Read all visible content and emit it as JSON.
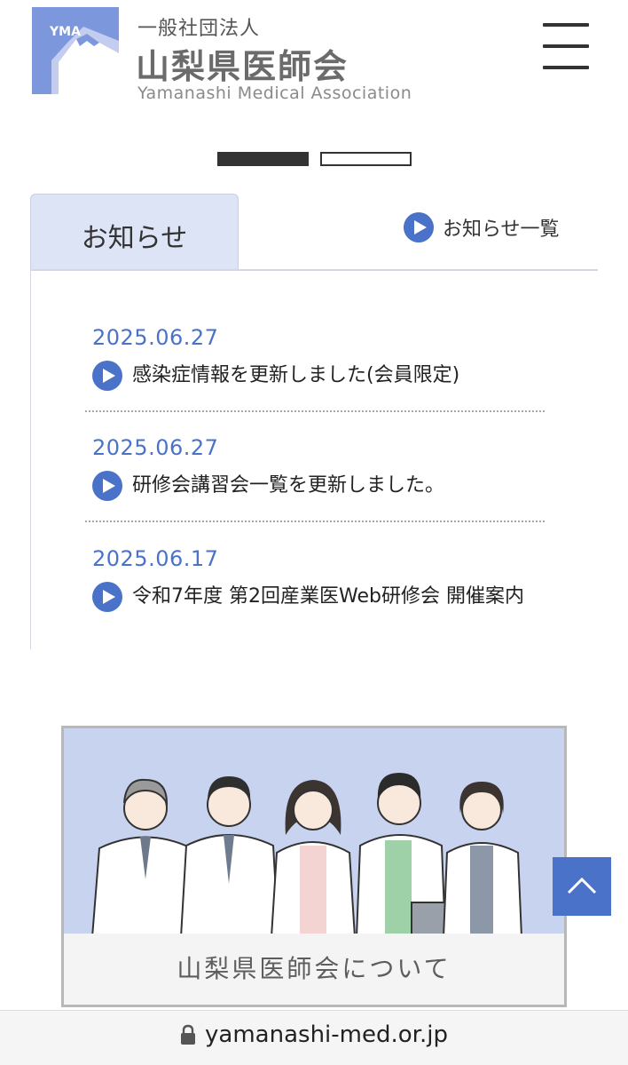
{
  "header": {
    "logo_badge": "YMA",
    "org_type": "一般社団法人",
    "org_name": "山梨県医師会",
    "org_name_en": "Yamanashi  Medical Association"
  },
  "slider": {
    "count": 2,
    "active_index": 0
  },
  "news": {
    "tab_label": "お知らせ",
    "list_link": "お知らせ一覧",
    "items": [
      {
        "date": "2025.06.27",
        "title": "感染症情報を更新しました(会員限定)"
      },
      {
        "date": "2025.06.27",
        "title": "研修会講習会一覧を更新しました。"
      },
      {
        "date": "2025.06.17",
        "title": "令和7年度 第2回産業医Web研修会 開催案内"
      }
    ]
  },
  "banner": {
    "caption": "山梨県医師会について"
  },
  "browser": {
    "url": "yamanashi-med.or.jp"
  },
  "icons": [
    "play-icon",
    "hamburger-icon",
    "chevron-up-icon",
    "lock-icon",
    "logo-mountain-icon"
  ],
  "colors": {
    "accent": "#4a72c9",
    "tab_bg": "#dde4f6",
    "banner_bg": "#c8d3f0"
  }
}
